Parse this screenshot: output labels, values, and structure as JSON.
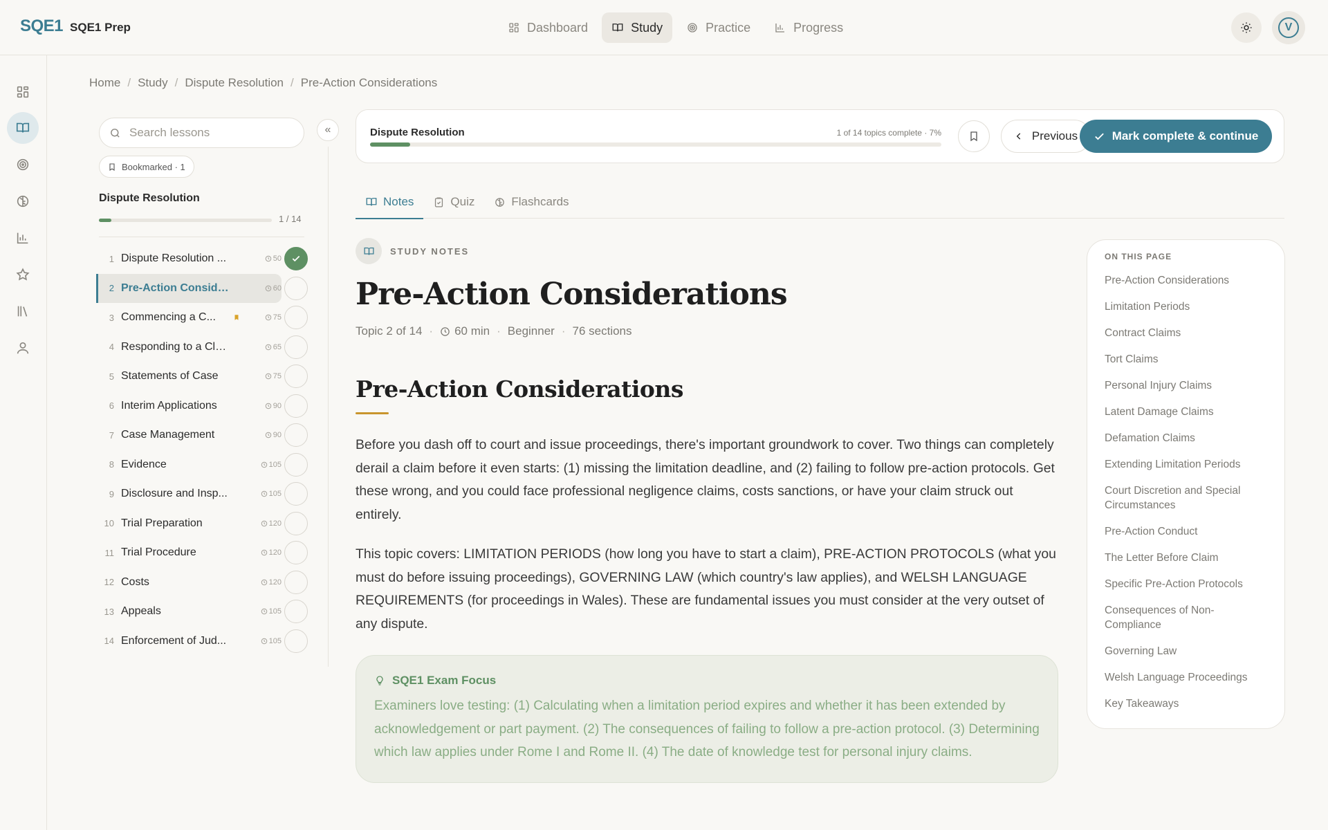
{
  "brand": {
    "logo": "SQE1",
    "name": "SQE1 Prep"
  },
  "topnav": [
    {
      "label": "Dashboard",
      "icon": "dashboard-icon"
    },
    {
      "label": "Study",
      "icon": "book-icon",
      "active": true
    },
    {
      "label": "Practice",
      "icon": "target-icon"
    },
    {
      "label": "Progress",
      "icon": "bar-chart-icon"
    }
  ],
  "user": {
    "initial": "V"
  },
  "rail": [
    "dashboard-icon",
    "book-icon",
    "target-icon",
    "brain-icon",
    "bar-chart-icon",
    "star-icon",
    "library-icon",
    "user-icon"
  ],
  "breadcrumb": [
    "Home",
    "Study",
    "Dispute Resolution",
    "Pre-Action Considerations"
  ],
  "sidebar": {
    "search_placeholder": "Search lessons",
    "bookmarked_label": "Bookmarked · 1",
    "group_title": "Dispute Resolution",
    "group_progress": 0.07,
    "group_count": "1 / 14",
    "lessons": [
      {
        "num": "1",
        "title": "Dispute Resolution ...",
        "duration": "50",
        "done": true
      },
      {
        "num": "2",
        "title": "Pre-Action Consider...",
        "duration": "60",
        "active": true
      },
      {
        "num": "3",
        "title": "Commencing a C...",
        "duration": "75",
        "bookmarked": true
      },
      {
        "num": "4",
        "title": "Responding to a Claim",
        "duration": "65"
      },
      {
        "num": "5",
        "title": "Statements of Case",
        "duration": "75"
      },
      {
        "num": "6",
        "title": "Interim Applications",
        "duration": "90"
      },
      {
        "num": "7",
        "title": "Case Management",
        "duration": "90"
      },
      {
        "num": "8",
        "title": "Evidence",
        "duration": "105"
      },
      {
        "num": "9",
        "title": "Disclosure and Insp...",
        "duration": "105"
      },
      {
        "num": "10",
        "title": "Trial Preparation",
        "duration": "120"
      },
      {
        "num": "11",
        "title": "Trial Procedure",
        "duration": "120"
      },
      {
        "num": "12",
        "title": "Costs",
        "duration": "120"
      },
      {
        "num": "13",
        "title": "Appeals",
        "duration": "105"
      },
      {
        "num": "14",
        "title": "Enforcement of Jud...",
        "duration": "105"
      }
    ]
  },
  "progress_card": {
    "title": "Dispute Resolution",
    "count": "1 of 14 topics complete · 7%",
    "progress": 0.07,
    "previous_label": "Previous",
    "complete_label": "Mark complete & continue"
  },
  "tabs": [
    {
      "label": "Notes",
      "icon": "book-icon",
      "active": true
    },
    {
      "label": "Quiz",
      "icon": "clipboard-icon"
    },
    {
      "label": "Flashcards",
      "icon": "brain-icon"
    }
  ],
  "content": {
    "label": "STUDY NOTES",
    "title": "Pre-Action Considerations",
    "meta": {
      "topic": "Topic 2 of 14",
      "duration": "60 min",
      "level": "Beginner",
      "sections": "76 sections"
    },
    "section_heading": "Pre-Action Considerations",
    "para1": "Before you dash off to court and issue proceedings, there's important groundwork to cover. Two things can completely derail a claim before it even starts: (1) missing the limitation deadline, and (2) failing to follow pre-action protocols. Get these wrong, and you could face professional negligence claims, costs sanctions, or have your claim struck out entirely.",
    "para2": "This topic covers: LIMITATION PERIODS (how long you have to start a claim), PRE-ACTION PROTOCOLS (what you must do before issuing proceedings), GOVERNING LAW (which country's law applies), and WELSH LANGUAGE REQUIREMENTS (for proceedings in Wales). These are fundamental issues you must consider at the very outset of any dispute.",
    "focus_title": "SQE1 Exam Focus",
    "focus_body": "Examiners love testing: (1) Calculating when a limitation period expires and whether it has been extended by acknowledgement or part payment. (2) The consequences of failing to follow a pre-action protocol. (3) Determining which law applies under Rome I and Rome II. (4) The date of knowledge test for personal injury claims."
  },
  "toc": {
    "title": "ON THIS PAGE",
    "items": [
      "Pre-Action Considerations",
      "Limitation Periods",
      "Contract Claims",
      "Tort Claims",
      "Personal Injury Claims",
      "Latent Damage Claims",
      "Defamation Claims",
      "Extending Limitation Periods",
      "Court Discretion and Special Circumstances",
      "Pre-Action Conduct",
      "The Letter Before Claim",
      "Specific Pre-Action Protocols",
      "Consequences of Non-Compliance",
      "Governing Law",
      "Welsh Language Proceedings",
      "Key Takeaways"
    ]
  },
  "colors": {
    "accent": "#3c7d92",
    "success": "#5e9063",
    "highlight": "#c9952d",
    "bookmark": "#d9a32a"
  }
}
